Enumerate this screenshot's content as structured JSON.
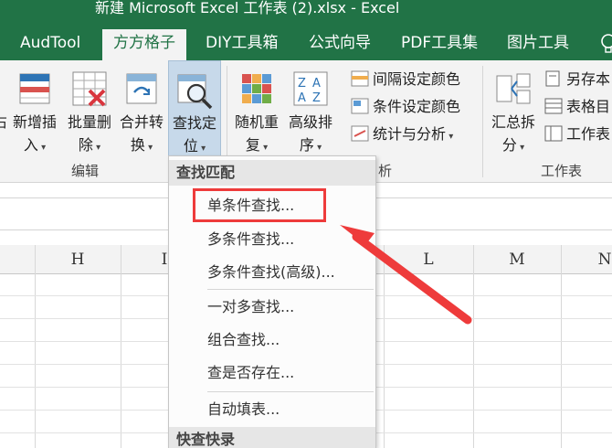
{
  "window": {
    "title": "新建 Microsoft Excel 工作表 (2).xlsx - Excel"
  },
  "tabs": [
    {
      "label": "AudTool"
    },
    {
      "label": "方方格子",
      "active": true
    },
    {
      "label": "DIY工具箱"
    },
    {
      "label": "公式向导"
    },
    {
      "label": "PDF工具集"
    },
    {
      "label": "图片工具"
    }
  ],
  "ribbon": {
    "partial_left": {
      "label": "右"
    },
    "buttons": {
      "insert": {
        "line1": "新增插",
        "line2": "入",
        "icon": "insert-rows-icon"
      },
      "delete": {
        "line1": "批量删",
        "line2": "除",
        "icon": "delete-icon"
      },
      "merge": {
        "line1": "合并转",
        "line2": "换",
        "icon": "merge-convert-icon"
      },
      "find": {
        "line1": "查找定",
        "line2": "位",
        "icon": "find-locate-icon"
      },
      "random": {
        "line1": "随机重",
        "line2": "复",
        "icon": "random-icon"
      },
      "sort": {
        "line1": "高级排",
        "line2": "序",
        "icon": "sort-icon"
      },
      "summary": {
        "line1": "汇总拆",
        "line2": "分",
        "icon": "summary-split-icon"
      }
    },
    "small_buttons": {
      "interval_color": "间隔设定颜色",
      "condition_color": "条件设定颜色",
      "stats": "统计与分析",
      "save_as": "另存本",
      "table_dir": "表格目",
      "worksheet": "工作表"
    },
    "groups": {
      "edit": "编辑",
      "analysis_tail": "析",
      "worksheet": "工作表"
    }
  },
  "columns": [
    "H",
    "I",
    "L",
    "M",
    "N"
  ],
  "menu": {
    "header1": "查找匹配",
    "items": [
      "单条件查找...",
      "多条件查找...",
      "多条件查找(高级)...",
      "一对多查找...",
      "组合查找...",
      "查是否存在...",
      "自动填表..."
    ],
    "header2": "快查快录"
  },
  "colors": {
    "excel_green": "#217346",
    "highlight_red": "#ee3b3b",
    "active_button": "#c7d9ea"
  }
}
